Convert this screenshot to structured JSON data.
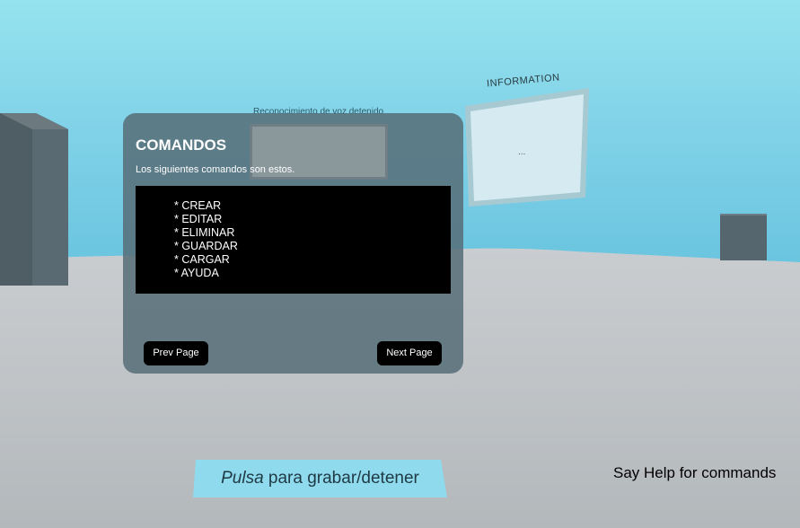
{
  "scene": {
    "status_text": "Reconocimiento de voz detenido",
    "help_text": "Say Help for commands"
  },
  "info_panel": {
    "title": "INFORMATION",
    "content": "..."
  },
  "commands_panel": {
    "title": "COMANDOS",
    "subtitle": "Los siguientes comandos son estos.",
    "commands": [
      "* CREAR",
      "* EDITAR",
      "* ELIMINAR",
      "* GUARDAR",
      "* CARGAR",
      "* AYUDA"
    ],
    "prev_label": "Prev Page",
    "next_label": "Next Page"
  },
  "record_button": {
    "label_em": "Pulsa",
    "label_rest": " para grabar/detener"
  },
  "colors": {
    "sky": "#82d3e8",
    "ground": "#b8bcbf",
    "panel": "#566e78",
    "record_button": "#8fdaec"
  }
}
